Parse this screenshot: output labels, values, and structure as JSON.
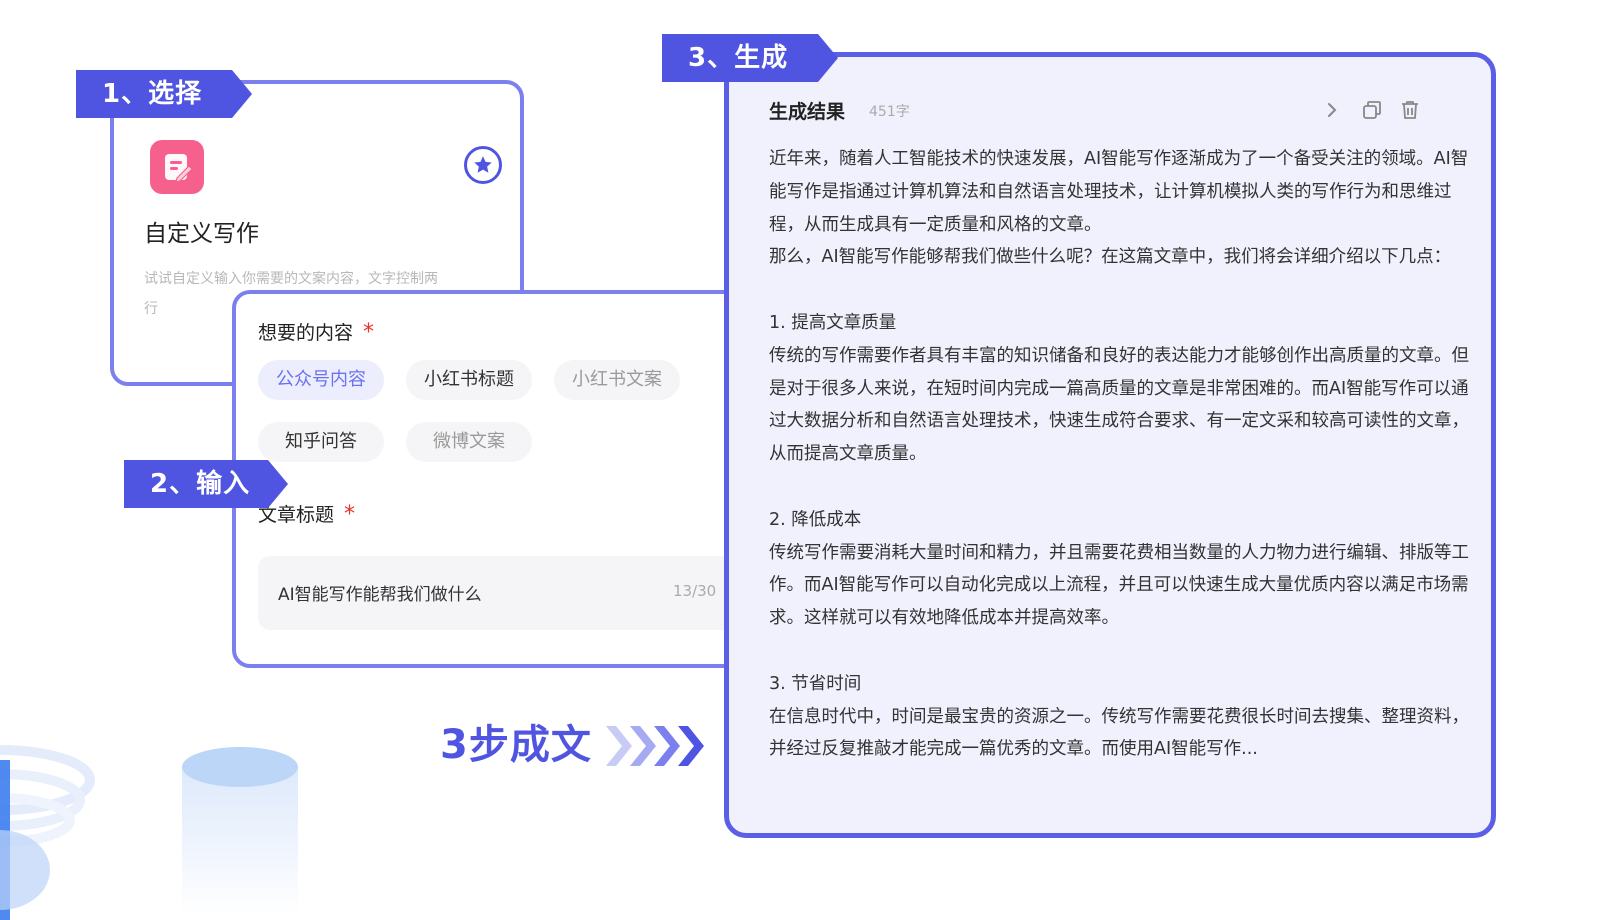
{
  "steps": {
    "select": "1、选择",
    "input": "2、输入",
    "generate": "3、生成"
  },
  "card1": {
    "title": "自定义写作",
    "desc": "试试自定义输入你需要的文案内容，文字控制两行"
  },
  "form": {
    "content_label": "想要的内容",
    "required_mark": "*",
    "chips": [
      "公众号内容",
      "小红书标题",
      "小红书文案",
      "知乎问答",
      "微博文案"
    ],
    "title_label": "文章标题",
    "title_value": "AI智能写作能帮我们做什么",
    "title_count": "13/30"
  },
  "slogan": "3步成文",
  "result": {
    "title": "生成结果",
    "count": "451字",
    "paragraphs": [
      "近年来，随着人工智能技术的快速发展，AI智能写作逐渐成为了一个备受关注的领域。AI智能写作是指通过计算机算法和自然语言处理技术，让计算机模拟人类的写作行为和思维过程，从而生成具有一定质量和风格的文章。",
      "那么，AI智能写作能够帮我们做些什么呢？在这篇文章中，我们将会详细介绍以下几点：",
      "1. 提高文章质量",
      "传统的写作需要作者具有丰富的知识储备和良好的表达能力才能够创作出高质量的文章。但是对于很多人来说，在短时间内完成一篇高质量的文章是非常困难的。而AI智能写作可以通过大数据分析和自然语言处理技术，快速生成符合要求、有一定文采和较高可读性的文章，从而提高文章质量。",
      "2. 降低成本",
      "传统写作需要消耗大量时间和精力，并且需要花费相当数量的人力物力进行编辑、排版等工作。而AI智能写作可以自动化完成以上流程，并且可以快速生成大量优质内容以满足市场需求。这样就可以有效地降低成本并提高效率。",
      "3. 节省时间",
      "在信息时代中，时间是最宝贵的资源之一。传统写作需要花费很长时间去搜集、整理资料，并经过反复推敲才能完成一篇优秀的文章。而使用AI智能写作..."
    ]
  },
  "icons": {
    "app": "edit-note-icon",
    "star": "star-icon",
    "arrow": "chevron-right-icon",
    "copy": "copy-icon",
    "delete": "trash-icon"
  },
  "colors": {
    "accent": "#4f55e0",
    "border": "#7b80ee",
    "pink": "#f5618c",
    "required": "#e8322e",
    "result_bg": "#f1f1fe"
  }
}
